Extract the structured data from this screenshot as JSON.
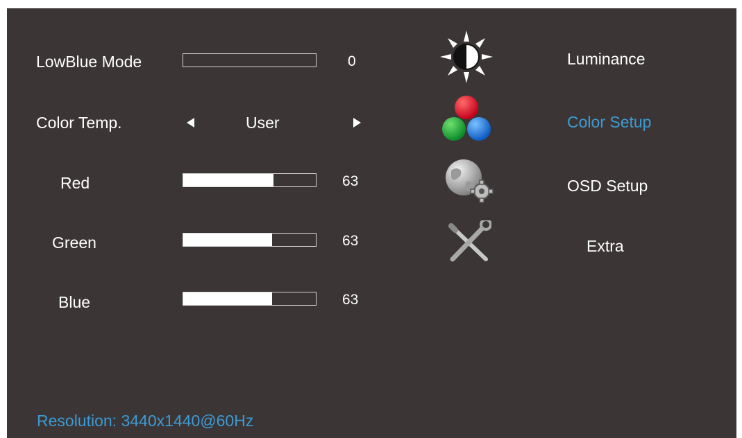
{
  "settings": {
    "lowblue": {
      "label": "LowBlue Mode",
      "value": "0",
      "level": 0
    },
    "color_temp": {
      "label": "Color Temp.",
      "value": "User"
    },
    "red": {
      "label": "Red",
      "value": "63",
      "level": 0.68
    },
    "green": {
      "label": "Green",
      "value": "63",
      "level": 0.67
    },
    "blue": {
      "label": "Blue",
      "value": "63",
      "level": 0.67
    }
  },
  "menu": [
    {
      "label": "Luminance",
      "icon": "sun-contrast-icon",
      "selected": false
    },
    {
      "label": "Color Setup",
      "icon": "rgb-circles-icon",
      "selected": true
    },
    {
      "label": "OSD Setup",
      "icon": "globe-gear-icon",
      "selected": false
    },
    {
      "label": "Extra",
      "icon": "wrench-screwdriver-icon",
      "selected": false
    }
  ],
  "status": {
    "resolution": "Resolution: 3440x1440@60Hz"
  },
  "colors": {
    "background": "#3b3635",
    "text": "#ffffff",
    "accent": "#3d9ad4"
  }
}
